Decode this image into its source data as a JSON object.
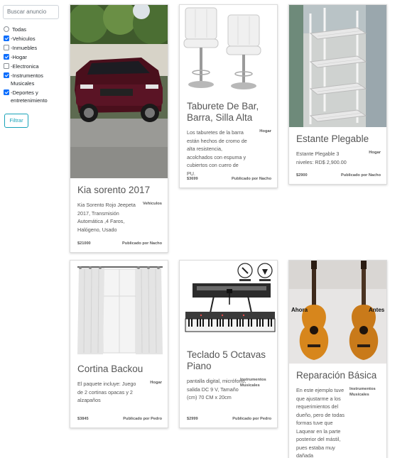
{
  "sidebar": {
    "search_placeholder": "Buscar anuncio",
    "all_label": "Todas",
    "categories": [
      {
        "label": "-Vehiculos",
        "checked": true
      },
      {
        "label": "-Inmuebles",
        "checked": false
      },
      {
        "label": "-Hogar",
        "checked": true
      },
      {
        "label": "-Electronica",
        "checked": false
      },
      {
        "label": "-Instrumentos Musicales",
        "checked": true
      },
      {
        "label": "-Deportes y entretenimiento",
        "checked": true
      }
    ],
    "filter_button": "Filtrar"
  },
  "listings": [
    {
      "title": "Kia sorento 2017",
      "description": "Kia Sorento Rojo Jeepeta 2017, Transmisión Automática ,4 Faros, Halógeno, Usado",
      "category": "Vehiculos",
      "price": "$21000",
      "publisher": "Publicado por Nacho"
    },
    {
      "title": "Taburete De Bar, Barra, Silla Alta",
      "description": "Los taburetes de la barra están hechos de cromo de alta resistencia, acolchados con espuma y cubiertos con cuero de PU.",
      "category": "Hogar",
      "price": "$3699",
      "publisher": "Publicado por Nacho"
    },
    {
      "title": "Estante Plegable",
      "description": "Estante Plegable 3 niveles: RD$ 2,900.00",
      "category": "Hogar",
      "price": "$2900",
      "publisher": "Publicado por Nacho"
    },
    {
      "title": "Cortina Backou",
      "description": "El paquete incluye: Juego de 2 cortinas opacas y 2 alzapaños",
      "category": "Hogar",
      "price": "$3845",
      "publisher": "Publicado por Pedro"
    },
    {
      "title": "Teclado 5 Octavas Piano",
      "description": "pantalla digital, micrófono, salida DC 9 V, Tamaño (cm) 70 CM x 20cm",
      "category": "Instrumentos Musicales",
      "price": "$2999",
      "publisher": "Publicado por Pedro"
    },
    {
      "title": "Reparación Básica",
      "description": "En este ejemplo tuve que ajustarme a los requerimientos del dueño, pero de todas formas tuve que Laquear en la parte posterior del mástil, pues estaba muy dañada",
      "category": "Instrumentos Musicales",
      "price": "",
      "publisher": ""
    }
  ],
  "image_text": {
    "guitar_before": "Ahora",
    "guitar_after": "Antes"
  }
}
